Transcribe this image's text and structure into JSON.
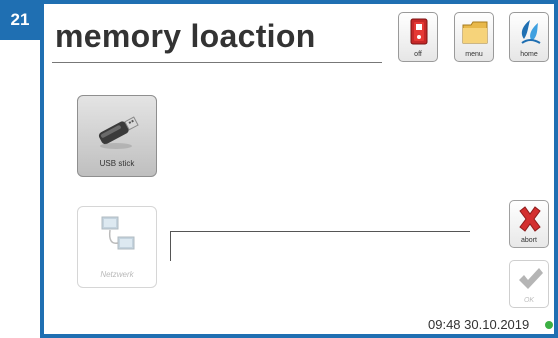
{
  "step_badge": "21",
  "page_title": "memory loaction",
  "toolbar": {
    "off_label": "off",
    "menu_label": "menu",
    "home_label": "home"
  },
  "tiles": {
    "usb_label": "USB stick",
    "network_label": "Netzwerk"
  },
  "path_field": {
    "value": ""
  },
  "actions": {
    "abort_label": "abort",
    "ok_label": "OK"
  },
  "status": {
    "time": "09:48",
    "date": "30.10.2019",
    "indicator_color": "#3cb043"
  },
  "colors": {
    "frame": "#1f6fb2",
    "abort_red": "#d32f2f"
  },
  "icons": [
    "power-switch-icon",
    "folder-icon",
    "home-drop-icon",
    "usb-stick-icon",
    "network-computers-icon",
    "x-icon",
    "checkmark-icon"
  ]
}
